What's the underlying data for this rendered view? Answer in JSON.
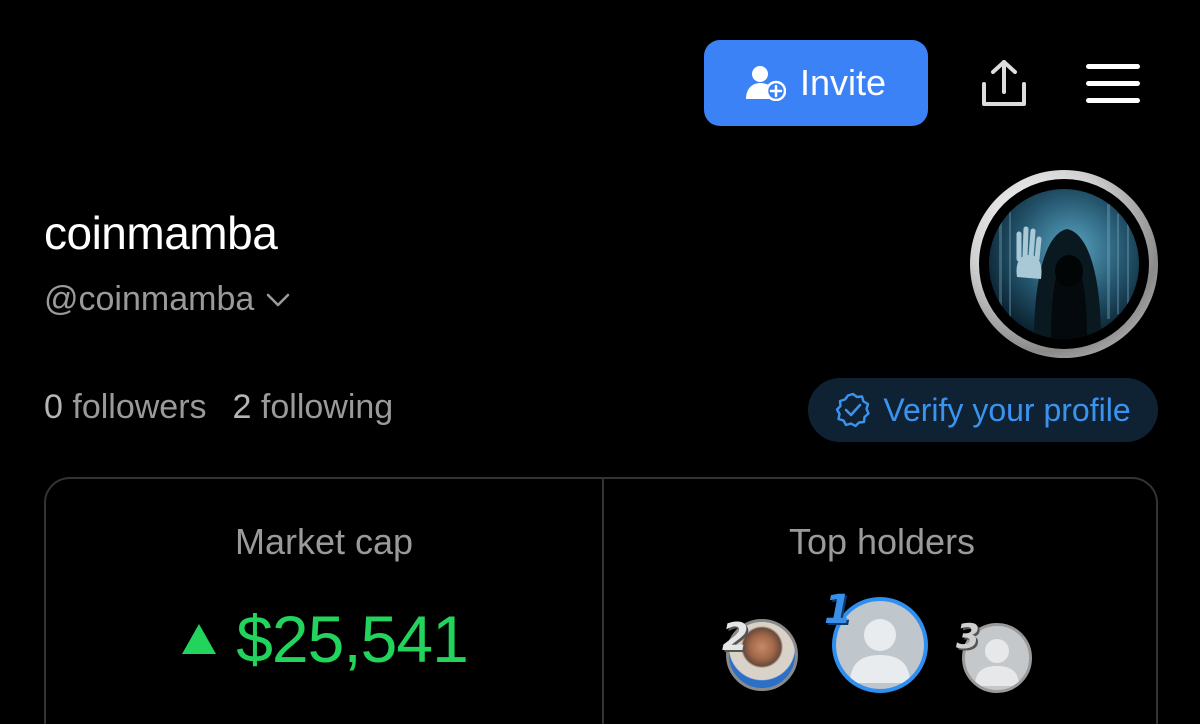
{
  "header": {
    "invite_label": "Invite",
    "invite_icon": "add-user-icon",
    "share_icon": "share-icon",
    "menu_icon": "hamburger-menu-icon"
  },
  "profile": {
    "display_name": "coinmamba",
    "handle": "@coinmamba",
    "followers_count": "0",
    "followers_label": "followers",
    "following_count": "2",
    "following_label": "following",
    "verify_label": "Verify your profile"
  },
  "stats_card": {
    "market_cap_label": "Market cap",
    "market_cap_value": "$25,541",
    "market_cap_trend": "up",
    "top_holders_label": "Top holders",
    "holders": [
      {
        "rank": "2"
      },
      {
        "rank": "1"
      },
      {
        "rank": "3"
      }
    ]
  },
  "colors": {
    "accent_blue": "#3b82f6",
    "verify_text": "#3b93f0",
    "positive_green": "#22d35c",
    "muted_text": "#9a9a9a",
    "background": "#000000"
  }
}
